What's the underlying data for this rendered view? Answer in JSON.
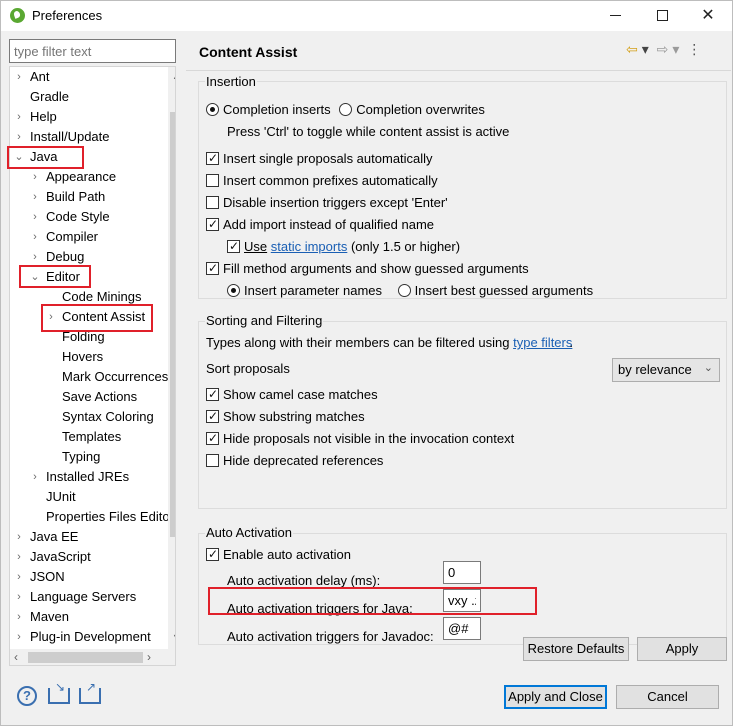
{
  "window": {
    "title": "Preferences"
  },
  "filter": {
    "placeholder": "type filter text"
  },
  "tree": [
    {
      "label": "Ant",
      "level": 0,
      "arrow": "›"
    },
    {
      "label": "Gradle",
      "level": 0,
      "arrow": ""
    },
    {
      "label": "Help",
      "level": 0,
      "arrow": "›"
    },
    {
      "label": "Install/Update",
      "level": 0,
      "arrow": "›"
    },
    {
      "label": "Java",
      "level": 0,
      "arrow": "⌄"
    },
    {
      "label": "Appearance",
      "level": 1,
      "arrow": "›"
    },
    {
      "label": "Build Path",
      "level": 1,
      "arrow": "›"
    },
    {
      "label": "Code Style",
      "level": 1,
      "arrow": "›"
    },
    {
      "label": "Compiler",
      "level": 1,
      "arrow": "›"
    },
    {
      "label": "Debug",
      "level": 1,
      "arrow": "›"
    },
    {
      "label": "Editor",
      "level": 1,
      "arrow": "⌄"
    },
    {
      "label": "Code Minings",
      "level": 2,
      "arrow": ""
    },
    {
      "label": "Content Assist",
      "level": 2,
      "arrow": "›"
    },
    {
      "label": "Folding",
      "level": 2,
      "arrow": ""
    },
    {
      "label": "Hovers",
      "level": 2,
      "arrow": ""
    },
    {
      "label": "Mark Occurrences",
      "level": 2,
      "arrow": ""
    },
    {
      "label": "Save Actions",
      "level": 2,
      "arrow": ""
    },
    {
      "label": "Syntax Coloring",
      "level": 2,
      "arrow": ""
    },
    {
      "label": "Templates",
      "level": 2,
      "arrow": ""
    },
    {
      "label": "Typing",
      "level": 2,
      "arrow": ""
    },
    {
      "label": "Installed JREs",
      "level": 1,
      "arrow": "›"
    },
    {
      "label": "JUnit",
      "level": 1,
      "arrow": ""
    },
    {
      "label": "Properties Files Editor",
      "level": 1,
      "arrow": ""
    },
    {
      "label": "Java EE",
      "level": 0,
      "arrow": "›"
    },
    {
      "label": "JavaScript",
      "level": 0,
      "arrow": "›"
    },
    {
      "label": "JSON",
      "level": 0,
      "arrow": "›"
    },
    {
      "label": "Language Servers",
      "level": 0,
      "arrow": "›"
    },
    {
      "label": "Maven",
      "level": 0,
      "arrow": "›"
    },
    {
      "label": "Plug-in Development",
      "level": 0,
      "arrow": "›"
    }
  ],
  "page": {
    "title": "Content Assist"
  },
  "insertion": {
    "label": "Insertion",
    "completion_inserts": "Completion inserts",
    "completion_overwrites": "Completion overwrites",
    "toggle_hint": "Press 'Ctrl' to toggle while content assist is active",
    "insert_single": "Insert single proposals automatically",
    "insert_common": "Insert common prefixes automatically",
    "disable_triggers": "Disable insertion triggers except 'Enter'",
    "add_import": "Add import instead of qualified name",
    "use": "Use",
    "static_imports": "static imports",
    "static_suffix": "(only 1.5 or higher)",
    "fill_method": "Fill method arguments and show guessed arguments",
    "insert_param_names": "Insert parameter names",
    "insert_best_guessed": "Insert best guessed arguments"
  },
  "sorting": {
    "label": "Sorting and Filtering",
    "types_text": "Types along with their members can be filtered using",
    "type_filters": "type filters",
    "period": ".",
    "sort_proposals": "Sort proposals",
    "sort_value": "by relevance",
    "camel_case": "Show camel case matches",
    "substring": "Show substring matches",
    "hide_not_visible": "Hide proposals not visible in the invocation context",
    "hide_deprecated": "Hide deprecated references"
  },
  "auto": {
    "label": "Auto Activation",
    "enable": "Enable auto activation",
    "delay_label": "Auto activation delay (ms):",
    "delay_value": "0",
    "java_label": "Auto activation triggers for Java:",
    "java_value": "vxy .z",
    "javadoc_label": "Auto activation triggers for Javadoc:",
    "javadoc_value": "@#"
  },
  "buttons": {
    "restore_defaults": "Restore Defaults",
    "apply": "Apply",
    "apply_close": "Apply and Close",
    "cancel": "Cancel"
  },
  "icons": {
    "help": "?",
    "nav_back": "⇦",
    "nav_forward": "⇨",
    "dropdown": "▾",
    "menu": "⋮",
    "select_chevron": "⌄",
    "scroll_up": "▲",
    "scroll_down": "▼",
    "scroll_left": "‹",
    "scroll_right": "›"
  },
  "colors": {
    "highlight_box": "#e0202a",
    "link": "#1a5fb4",
    "default_button": "#0078d7"
  }
}
